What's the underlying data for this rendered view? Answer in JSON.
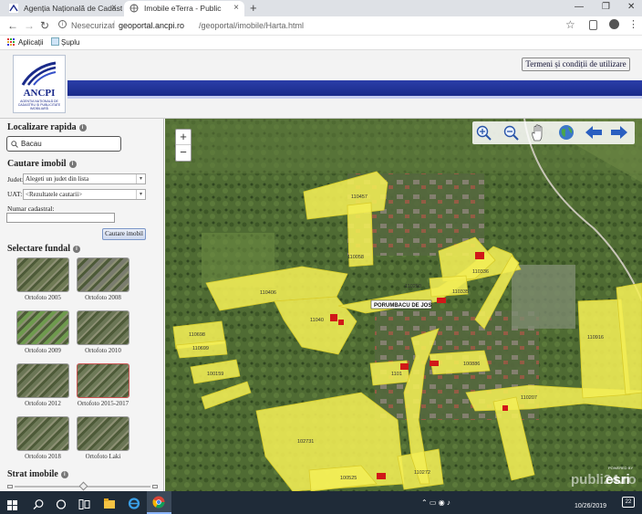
{
  "browser": {
    "tabs": [
      {
        "title": "Agenția Națională de Cadastru și",
        "active": false
      },
      {
        "title": "Imobile eTerra - Public",
        "active": true
      }
    ],
    "new_tab": "+",
    "security_label": "Nesecurizat",
    "url_host": "geoportal.ancpi.ro",
    "url_path": "/geoportal/imobile/Harta.html",
    "bookmarks": [
      "Aplicații",
      "Șuplu"
    ]
  },
  "header": {
    "logo_text": "ANCPI",
    "logo_subtext": "AGENȚIA NAȚIONALĂ DE CADASTRU ȘI PUBLICITATE IMOBILIARĂ",
    "terms_button": "Termeni și condiții de utilizare"
  },
  "sidebar": {
    "quick_locate_title": "Localizare rapida",
    "search_value": "Bacau",
    "search_title": "Cautare imobil",
    "judet_label": "Judet:",
    "judet_value": "Alegeti un judet din lista",
    "uat_label": "UAT:",
    "uat_value": "<Rezultatele cautarii>",
    "cadastral_label": "Numar cadastral:",
    "cadastral_value": "",
    "search_button": "Cautare imobil",
    "background_title": "Selectare fundal",
    "backgrounds": [
      {
        "label": "Ortofoto 2005",
        "selected": false
      },
      {
        "label": "Ortofoto 2008",
        "selected": false
      },
      {
        "label": "Ortofoto 2009",
        "selected": false
      },
      {
        "label": "Ortofoto 2010",
        "selected": false
      },
      {
        "label": "Ortofoto 2012",
        "selected": false
      },
      {
        "label": "Ortofoto 2015-2017",
        "selected": true
      },
      {
        "label": "Ortofoto 2018",
        "selected": false
      },
      {
        "label": "Ortofoto Laki",
        "selected": false
      }
    ],
    "layer_title": "Strat imobile",
    "layer_opacity": 0.5
  },
  "map": {
    "zoom_in": "+",
    "zoom_out": "−",
    "village_label": "PORUMBACU DE JOS",
    "parcels": [
      "110457",
      "110058",
      "110406",
      "110250",
      "110336",
      "110335",
      "11040",
      "110698",
      "110699",
      "100159",
      "1101",
      "100886",
      "110207",
      "102731",
      "100525",
      "110272",
      "110916"
    ],
    "tools": [
      "zoom-in-tool-icon",
      "zoom-out-tool-icon",
      "pan-hand-icon",
      "full-extent-globe-icon",
      "previous-extent-icon",
      "next-extent-icon"
    ],
    "powered_by": "POWERED BY",
    "esri_logo": "esri",
    "watermark": "publi24.ro"
  },
  "taskbar": {
    "time": "",
    "date": "10/26/2019",
    "notifications": "22"
  },
  "colors": {
    "parcel_fill": "#f2ee55",
    "header_band": "#2b3ea8",
    "taskbar": "#1f2b38"
  }
}
